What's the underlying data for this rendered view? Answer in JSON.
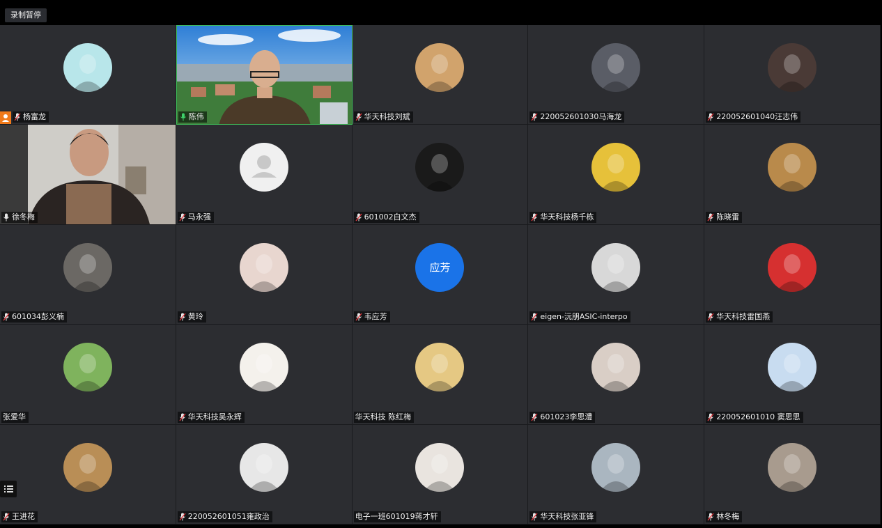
{
  "recording_badge": "录制暂停",
  "participants": [
    {
      "name": "杨富龙",
      "avatar_bg": "#b8e6ea",
      "mic": "muted",
      "host": true
    },
    {
      "name": "陈伟",
      "avatar_bg": null,
      "mic": "active",
      "video": "man-city-bg"
    },
    {
      "name": "华天科技刘斌",
      "avatar_bg": "#d1a36c",
      "mic": "muted"
    },
    {
      "name": "220052601030马海龙",
      "avatar_bg": "#5a5d66",
      "mic": "muted"
    },
    {
      "name": "220052601040汪志伟",
      "avatar_bg": "#4a3a36",
      "mic": "muted"
    },
    {
      "name": "徐冬梅",
      "avatar_bg": null,
      "mic": "normal",
      "video": "woman-room"
    },
    {
      "name": "马永强",
      "avatar_bg": "#f0f0f0",
      "mic": "muted",
      "default_avatar": true
    },
    {
      "name": "601002白文杰",
      "avatar_bg": "#1a1a1a",
      "mic": "muted"
    },
    {
      "name": "华天科技杨千栋",
      "avatar_bg": "#e6c13a",
      "mic": "muted"
    },
    {
      "name": "陈晓雷",
      "avatar_bg": "#b98a4b",
      "mic": "muted"
    },
    {
      "name": "601034彭义楠",
      "avatar_bg": "#6b6864",
      "mic": "muted"
    },
    {
      "name": "黄玲",
      "avatar_bg": "#e8d6cf",
      "mic": "muted"
    },
    {
      "name": "韦应芳",
      "avatar_bg": "#1a73e8",
      "mic": "muted",
      "avatar_text": "应芳"
    },
    {
      "name": "eigen-沅朋ASIC-interpo",
      "avatar_bg": "#d8d8d8",
      "mic": "muted"
    },
    {
      "name": "华天科技雷国燕",
      "avatar_bg": "#d63030",
      "mic": "muted"
    },
    {
      "name": "张爱华",
      "avatar_bg": "#7fb35d",
      "mic": "none"
    },
    {
      "name": "华天科技吴永辉",
      "avatar_bg": "#f4f1ec",
      "mic": "muted"
    },
    {
      "name": "华天科技  陈红梅",
      "avatar_bg": "#e5c883",
      "mic": "none"
    },
    {
      "name": "601023李思澧",
      "avatar_bg": "#d9cec6",
      "mic": "muted"
    },
    {
      "name": "220052601010 窦思思",
      "avatar_bg": "#c8dcf0",
      "mic": "muted"
    },
    {
      "name": "王进花",
      "avatar_bg": "#b98e56",
      "mic": "muted"
    },
    {
      "name": "220052601051雍政治",
      "avatar_bg": "#e7e7e7",
      "mic": "muted"
    },
    {
      "name": "电子一班601019蒋才轩",
      "avatar_bg": "#e9e4df",
      "mic": "none"
    },
    {
      "name": "华天科技张亚锋",
      "avatar_bg": "#aab6c0",
      "mic": "muted"
    },
    {
      "name": "林冬梅",
      "avatar_bg": "#a89b8e",
      "mic": "muted"
    }
  ]
}
